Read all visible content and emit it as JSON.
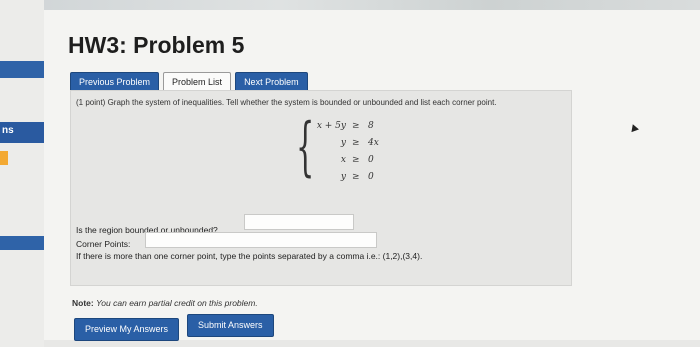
{
  "sidebar": {
    "fragment_label": "ns"
  },
  "problem": {
    "title": "HW3: Problem 5"
  },
  "nav": {
    "previous": "Previous Problem",
    "list": "Problem List",
    "next": "Next Problem"
  },
  "statement": "(1 point) Graph the system of inequalities. Tell whether the system is bounded or unbounded and list each corner point.",
  "system": [
    {
      "lhs": "x + 5y",
      "op": "≥",
      "rhs": "8"
    },
    {
      "lhs": "y",
      "op": "≥",
      "rhs": "4x"
    },
    {
      "lhs": "x",
      "op": "≥",
      "rhs": "0"
    },
    {
      "lhs": "y",
      "op": "≥",
      "rhs": "0"
    }
  ],
  "questions": {
    "bounded_label": "Is the region bounded or unbounded?",
    "bounded_value": "",
    "corner_label": "Corner Points:",
    "corner_value": "",
    "hint": "If there is more than one corner point, type the points separated by a comma i.e.: (1,2),(3,4)."
  },
  "note": {
    "bold": "Note:",
    "text": "You can earn partial credit on this problem."
  },
  "actions": {
    "preview": "Preview My Answers",
    "submit": "Submit Answers"
  },
  "colors": {
    "accent": "#2a5fa6",
    "sidebar_accent": "#f3a933"
  }
}
